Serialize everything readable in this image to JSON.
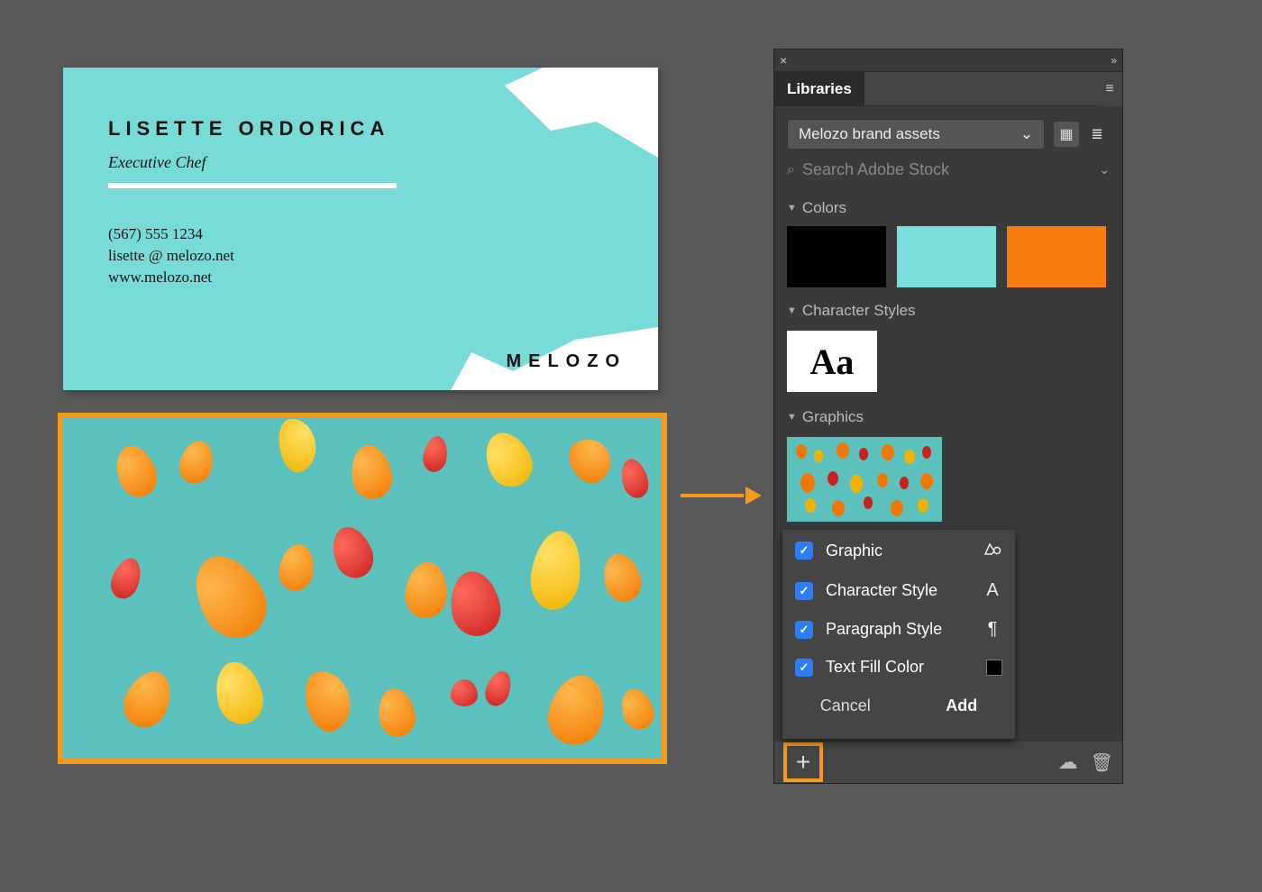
{
  "business_card": {
    "name": "LISETTE ORDORICA",
    "title": "Executive Chef",
    "phone": "(567) 555 1234",
    "email": "lisette @ melozo.net",
    "website": "www.melozo.net",
    "brand": "MELOZO"
  },
  "panel": {
    "tab_label": "Libraries",
    "library_name": "Melozo brand assets",
    "search_placeholder": "Search Adobe Stock",
    "sections": {
      "colors": "Colors",
      "char_styles": "Character Styles",
      "graphics": "Graphics"
    },
    "char_style_sample": "Aa",
    "swatches": {
      "black": "#000000",
      "teal": "#79dfdb",
      "orange": "#f77d0f"
    }
  },
  "popup": {
    "items": {
      "graphic": "Graphic",
      "char_style": "Character Style",
      "para_style": "Paragraph Style",
      "text_fill": "Text Fill Color"
    },
    "cancel": "Cancel",
    "add": "Add"
  },
  "icons": {
    "close": "×",
    "collapse": "»",
    "menu": "≡",
    "grid": "▦",
    "list": "≣",
    "dropdown": "⌄",
    "section_caret": "▼",
    "search": "⌕",
    "plus": "+",
    "cloud": "☁",
    "trash": "🗑",
    "graphic": "⬚",
    "char_A": "A",
    "pilcrow": "¶"
  }
}
